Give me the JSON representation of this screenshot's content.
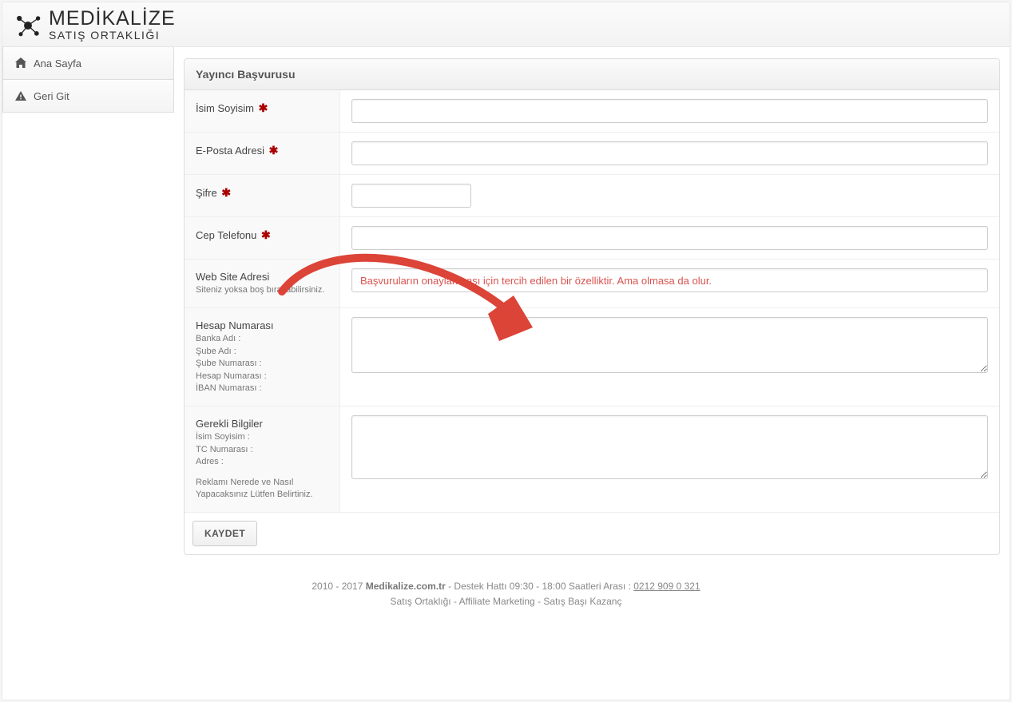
{
  "header": {
    "brand_main": "MEDİKALİZE",
    "brand_sub": "SATIŞ ORTAKLIĞI"
  },
  "sidebar": {
    "items": [
      {
        "label": "Ana Sayfa"
      },
      {
        "label": "Geri Git"
      }
    ]
  },
  "form": {
    "title": "Yayıncı Başvurusu",
    "fields": {
      "name": {
        "label": "İsim Soyisim",
        "value": ""
      },
      "email": {
        "label": "E-Posta Adresi",
        "value": ""
      },
      "password": {
        "label": "Şifre",
        "value": ""
      },
      "phone": {
        "label": "Cep Telefonu",
        "value": ""
      },
      "website": {
        "label": "Web Site Adresi",
        "sub": "Siteniz yoksa boş bırakabilirsiniz.",
        "placeholder": "Başvuruların onaylanması için tercih edilen bir özelliktir. Ama olmasa da olur.",
        "value": ""
      },
      "account": {
        "label": "Hesap Numarası",
        "sub1": "Banka Adı :",
        "sub2": "Şube Adı :",
        "sub3": "Şube Numarası :",
        "sub4": "Hesap Numarası :",
        "sub5": "İBAN Numarası :",
        "value": ""
      },
      "required": {
        "label": "Gerekli Bilgiler",
        "sub1": "İsim Soyisim :",
        "sub2": "TC Numarası :",
        "sub3": "Adres :",
        "sub4": "Reklamı Nerede ve Nasıl Yapacaksınız Lütfen Belirtiniz.",
        "value": ""
      }
    },
    "save_label": "KAYDET"
  },
  "footer": {
    "line1_a": "2010 - 2017 ",
    "line1_domain": "Medikalize.com.tr",
    "line1_b": " - Destek Hattı 09:30 - 18:00 Saatleri Arası : ",
    "line1_phone": "0212 909 0 321",
    "line2": "Satış Ortaklığı - Affiliate Marketing - Satış Başı Kazanç"
  },
  "annotation": {
    "arrow_color": "#db4437"
  }
}
